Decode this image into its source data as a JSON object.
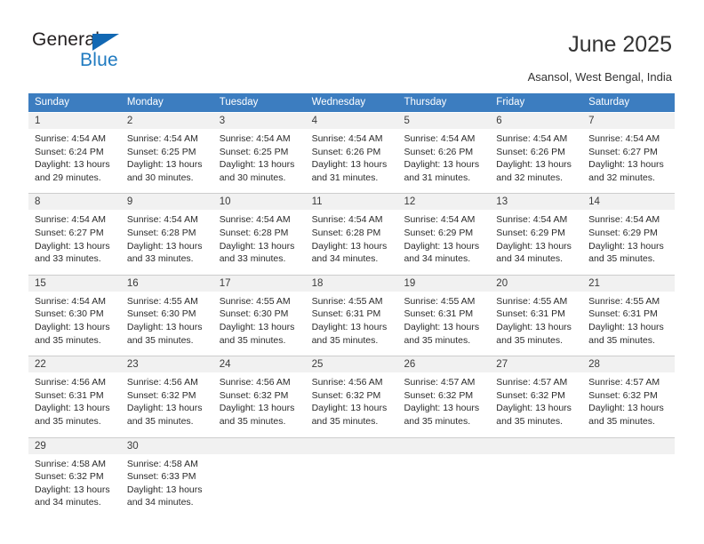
{
  "brand": {
    "name_part1": "General",
    "name_part2": "Blue",
    "triangle_color": "#1268b3",
    "blue_color": "#1f7ac0"
  },
  "header": {
    "title": "June 2025",
    "location": "Asansol, West Bengal, India"
  },
  "theme": {
    "header_bg": "#3c7dc0",
    "header_text": "#ffffff",
    "daynum_bg": "#f1f1f1",
    "cell_bg": "#ffffff",
    "grid_line": "#cdcdcd",
    "body_text": "#2b2b2b"
  },
  "weekdays": [
    "Sunday",
    "Monday",
    "Tuesday",
    "Wednesday",
    "Thursday",
    "Friday",
    "Saturday"
  ],
  "labels": {
    "sunrise_prefix": "Sunrise:",
    "sunset_prefix": "Sunset:",
    "daylight_prefix": "Daylight:"
  },
  "weeks": [
    {
      "days": [
        {
          "num": "1",
          "sunrise": "Sunrise: 4:54 AM",
          "sunset": "Sunset: 6:24 PM",
          "daylight_1": "Daylight: 13 hours",
          "daylight_2": "and 29 minutes."
        },
        {
          "num": "2",
          "sunrise": "Sunrise: 4:54 AM",
          "sunset": "Sunset: 6:25 PM",
          "daylight_1": "Daylight: 13 hours",
          "daylight_2": "and 30 minutes."
        },
        {
          "num": "3",
          "sunrise": "Sunrise: 4:54 AM",
          "sunset": "Sunset: 6:25 PM",
          "daylight_1": "Daylight: 13 hours",
          "daylight_2": "and 30 minutes."
        },
        {
          "num": "4",
          "sunrise": "Sunrise: 4:54 AM",
          "sunset": "Sunset: 6:26 PM",
          "daylight_1": "Daylight: 13 hours",
          "daylight_2": "and 31 minutes."
        },
        {
          "num": "5",
          "sunrise": "Sunrise: 4:54 AM",
          "sunset": "Sunset: 6:26 PM",
          "daylight_1": "Daylight: 13 hours",
          "daylight_2": "and 31 minutes."
        },
        {
          "num": "6",
          "sunrise": "Sunrise: 4:54 AM",
          "sunset": "Sunset: 6:26 PM",
          "daylight_1": "Daylight: 13 hours",
          "daylight_2": "and 32 minutes."
        },
        {
          "num": "7",
          "sunrise": "Sunrise: 4:54 AM",
          "sunset": "Sunset: 6:27 PM",
          "daylight_1": "Daylight: 13 hours",
          "daylight_2": "and 32 minutes."
        }
      ]
    },
    {
      "days": [
        {
          "num": "8",
          "sunrise": "Sunrise: 4:54 AM",
          "sunset": "Sunset: 6:27 PM",
          "daylight_1": "Daylight: 13 hours",
          "daylight_2": "and 33 minutes."
        },
        {
          "num": "9",
          "sunrise": "Sunrise: 4:54 AM",
          "sunset": "Sunset: 6:28 PM",
          "daylight_1": "Daylight: 13 hours",
          "daylight_2": "and 33 minutes."
        },
        {
          "num": "10",
          "sunrise": "Sunrise: 4:54 AM",
          "sunset": "Sunset: 6:28 PM",
          "daylight_1": "Daylight: 13 hours",
          "daylight_2": "and 33 minutes."
        },
        {
          "num": "11",
          "sunrise": "Sunrise: 4:54 AM",
          "sunset": "Sunset: 6:28 PM",
          "daylight_1": "Daylight: 13 hours",
          "daylight_2": "and 34 minutes."
        },
        {
          "num": "12",
          "sunrise": "Sunrise: 4:54 AM",
          "sunset": "Sunset: 6:29 PM",
          "daylight_1": "Daylight: 13 hours",
          "daylight_2": "and 34 minutes."
        },
        {
          "num": "13",
          "sunrise": "Sunrise: 4:54 AM",
          "sunset": "Sunset: 6:29 PM",
          "daylight_1": "Daylight: 13 hours",
          "daylight_2": "and 34 minutes."
        },
        {
          "num": "14",
          "sunrise": "Sunrise: 4:54 AM",
          "sunset": "Sunset: 6:29 PM",
          "daylight_1": "Daylight: 13 hours",
          "daylight_2": "and 35 minutes."
        }
      ]
    },
    {
      "days": [
        {
          "num": "15",
          "sunrise": "Sunrise: 4:54 AM",
          "sunset": "Sunset: 6:30 PM",
          "daylight_1": "Daylight: 13 hours",
          "daylight_2": "and 35 minutes."
        },
        {
          "num": "16",
          "sunrise": "Sunrise: 4:55 AM",
          "sunset": "Sunset: 6:30 PM",
          "daylight_1": "Daylight: 13 hours",
          "daylight_2": "and 35 minutes."
        },
        {
          "num": "17",
          "sunrise": "Sunrise: 4:55 AM",
          "sunset": "Sunset: 6:30 PM",
          "daylight_1": "Daylight: 13 hours",
          "daylight_2": "and 35 minutes."
        },
        {
          "num": "18",
          "sunrise": "Sunrise: 4:55 AM",
          "sunset": "Sunset: 6:31 PM",
          "daylight_1": "Daylight: 13 hours",
          "daylight_2": "and 35 minutes."
        },
        {
          "num": "19",
          "sunrise": "Sunrise: 4:55 AM",
          "sunset": "Sunset: 6:31 PM",
          "daylight_1": "Daylight: 13 hours",
          "daylight_2": "and 35 minutes."
        },
        {
          "num": "20",
          "sunrise": "Sunrise: 4:55 AM",
          "sunset": "Sunset: 6:31 PM",
          "daylight_1": "Daylight: 13 hours",
          "daylight_2": "and 35 minutes."
        },
        {
          "num": "21",
          "sunrise": "Sunrise: 4:55 AM",
          "sunset": "Sunset: 6:31 PM",
          "daylight_1": "Daylight: 13 hours",
          "daylight_2": "and 35 minutes."
        }
      ]
    },
    {
      "days": [
        {
          "num": "22",
          "sunrise": "Sunrise: 4:56 AM",
          "sunset": "Sunset: 6:31 PM",
          "daylight_1": "Daylight: 13 hours",
          "daylight_2": "and 35 minutes."
        },
        {
          "num": "23",
          "sunrise": "Sunrise: 4:56 AM",
          "sunset": "Sunset: 6:32 PM",
          "daylight_1": "Daylight: 13 hours",
          "daylight_2": "and 35 minutes."
        },
        {
          "num": "24",
          "sunrise": "Sunrise: 4:56 AM",
          "sunset": "Sunset: 6:32 PM",
          "daylight_1": "Daylight: 13 hours",
          "daylight_2": "and 35 minutes."
        },
        {
          "num": "25",
          "sunrise": "Sunrise: 4:56 AM",
          "sunset": "Sunset: 6:32 PM",
          "daylight_1": "Daylight: 13 hours",
          "daylight_2": "and 35 minutes."
        },
        {
          "num": "26",
          "sunrise": "Sunrise: 4:57 AM",
          "sunset": "Sunset: 6:32 PM",
          "daylight_1": "Daylight: 13 hours",
          "daylight_2": "and 35 minutes."
        },
        {
          "num": "27",
          "sunrise": "Sunrise: 4:57 AM",
          "sunset": "Sunset: 6:32 PM",
          "daylight_1": "Daylight: 13 hours",
          "daylight_2": "and 35 minutes."
        },
        {
          "num": "28",
          "sunrise": "Sunrise: 4:57 AM",
          "sunset": "Sunset: 6:32 PM",
          "daylight_1": "Daylight: 13 hours",
          "daylight_2": "and 35 minutes."
        }
      ]
    },
    {
      "days": [
        {
          "num": "29",
          "sunrise": "Sunrise: 4:58 AM",
          "sunset": "Sunset: 6:32 PM",
          "daylight_1": "Daylight: 13 hours",
          "daylight_2": "and 34 minutes."
        },
        {
          "num": "30",
          "sunrise": "Sunrise: 4:58 AM",
          "sunset": "Sunset: 6:33 PM",
          "daylight_1": "Daylight: 13 hours",
          "daylight_2": "and 34 minutes."
        },
        {
          "num": "",
          "sunrise": "",
          "sunset": "",
          "daylight_1": "",
          "daylight_2": ""
        },
        {
          "num": "",
          "sunrise": "",
          "sunset": "",
          "daylight_1": "",
          "daylight_2": ""
        },
        {
          "num": "",
          "sunrise": "",
          "sunset": "",
          "daylight_1": "",
          "daylight_2": ""
        },
        {
          "num": "",
          "sunrise": "",
          "sunset": "",
          "daylight_1": "",
          "daylight_2": ""
        },
        {
          "num": "",
          "sunrise": "",
          "sunset": "",
          "daylight_1": "",
          "daylight_2": ""
        }
      ]
    }
  ]
}
